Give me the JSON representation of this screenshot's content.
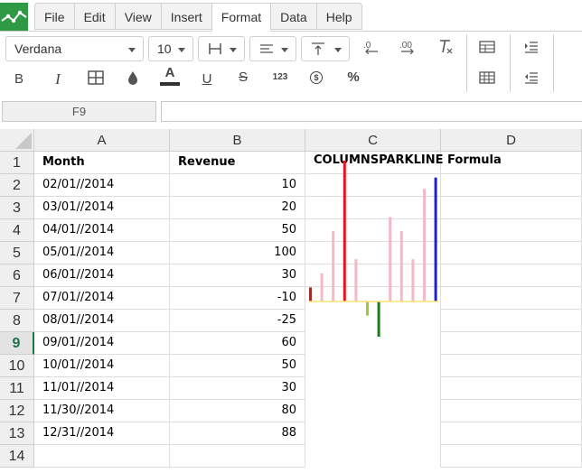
{
  "menu": [
    "File",
    "Edit",
    "View",
    "Insert",
    "Format",
    "Data",
    "Help"
  ],
  "active_menu": "Format",
  "toolbar": {
    "font_family": "Verdana",
    "font_size": "10",
    "bold": "B",
    "italic": "I",
    "font_color_glyph": "A",
    "underline": "U",
    "strike": "S",
    "number_format": "123",
    "currency": "$",
    "percent": "%"
  },
  "name_box": "F9",
  "formula_value": "",
  "columns": [
    "A",
    "B",
    "C",
    "D"
  ],
  "rows": [
    "1",
    "2",
    "3",
    "4",
    "5",
    "6",
    "7",
    "8",
    "9",
    "10",
    "11",
    "12",
    "13",
    "14"
  ],
  "selected_row": "9",
  "cells": {
    "A1": "Month",
    "B1": "Revenue",
    "C1": "COLUMNSPARKLINE Formula",
    "A2": "02/01//2014",
    "B2": "10",
    "A3": "03/01//2014",
    "B3": "20",
    "A4": "04/01//2014",
    "B4": "50",
    "A5": "05/01//2014",
    "B5": "100",
    "A6": "06/01//2014",
    "B6": "30",
    "A7": "07/01//2014",
    "B7": "-10",
    "A8": "08/01//2014",
    "B8": "-25",
    "A9": "09/01//2014",
    "B9": "60",
    "A10": "10/01//2014",
    "B10": "50",
    "A11": "11/01//2014",
    "B11": "30",
    "A12": "11/30//2014",
    "B12": "80",
    "A13": "12/31//2014",
    "B13": "88"
  },
  "chart_data": {
    "type": "bar",
    "categories": [
      "02/01//2014",
      "03/01//2014",
      "04/01//2014",
      "05/01//2014",
      "06/01//2014",
      "07/01//2014",
      "08/01//2014",
      "09/01//2014",
      "10/01//2014",
      "11/01//2014",
      "11/30//2014",
      "12/31//2014"
    ],
    "values": [
      10,
      20,
      50,
      100,
      30,
      -10,
      -25,
      60,
      50,
      30,
      80,
      88
    ],
    "colors": {
      "default": "#f5b8c4",
      "first": "#a52a2a",
      "high": "#e8131f",
      "low": "#1e7a1e",
      "negative": "#9acd32",
      "last": "#1f1fd0",
      "axis": "#ffe36e"
    }
  }
}
